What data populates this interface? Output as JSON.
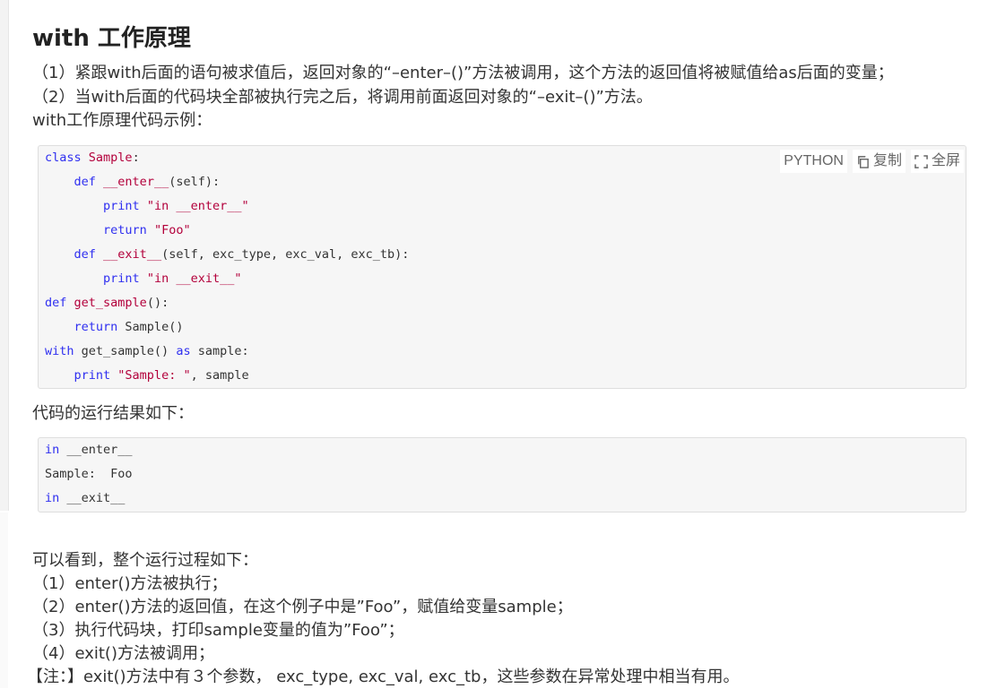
{
  "title": "with 工作原理",
  "intro": [
    "（1）紧跟with后面的语句被求值后，返回对象的“–enter–()”方法被调用，这个方法的返回值将被赋值给as后面的变量；",
    "（2）当with后面的代码块全部被执行完之后，将调用前面返回对象的“–exit–()”方法。",
    "with工作原理代码示例："
  ],
  "code_toolbar": {
    "language": "PYTHON",
    "copy_label": "复制",
    "fullscreen_label": "全屏"
  },
  "code_lines": [
    "class Sample:",
    "    def __enter__(self):",
    "        print \"in __enter__\"",
    "        return \"Foo\"",
    "    def __exit__(self, exc_type, exc_val, exc_tb):",
    "        print \"in __exit__\"",
    "def get_sample():",
    "    return Sample()",
    "with get_sample() as sample:",
    "    print \"Sample: \", sample"
  ],
  "result_heading": "代码的运行结果如下：",
  "output_lines": [
    "in __enter__",
    "Sample:  Foo",
    "in __exit__"
  ],
  "summary": [
    "可以看到，整个运行过程如下：",
    "（1）enter()方法被执行；",
    "（2）enter()方法的返回值，在这个例子中是”Foo”，赋值给变量sample；",
    "（3）执行代码块，打印sample变量的值为”Foo”；",
    "（4）exit()方法被调用；",
    "【注：】exit()方法中有３个参数， exc_type, exc_val, exc_tb，这些参数在异常处理中相当有用。"
  ]
}
